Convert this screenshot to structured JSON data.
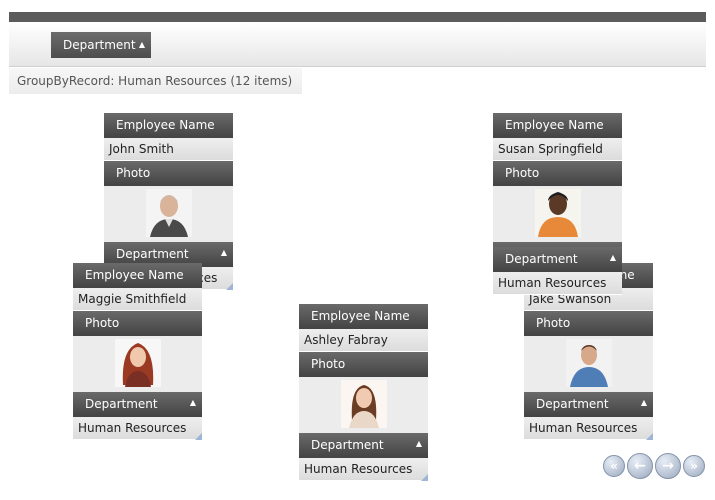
{
  "toolbar": {
    "group_chip_label": "Department"
  },
  "group": {
    "label": "GroupByRecord: Human Resources (12 items)"
  },
  "labels": {
    "name_header": "Employee Name",
    "photo_header": "Photo",
    "dept_header": "Department"
  },
  "cards": [
    {
      "name": "John Smith",
      "department": "Human Resources",
      "photo": "avatar-man-grey-hair"
    },
    {
      "name": "Susan Springfield",
      "department": "Human Resources",
      "photo": "avatar-woman-orange-top"
    },
    {
      "name": "Maggie Smithfield",
      "department": "Human Resources",
      "photo": "avatar-woman-red-hair"
    },
    {
      "name": "Jake Swanson",
      "department": "Human Resources",
      "photo": "avatar-man-denim-shirt"
    },
    {
      "name": "Ashley Fabray",
      "department": "Human Resources",
      "photo": "avatar-woman-brown-hair"
    }
  ],
  "pager": {
    "first_icon": "double-left-icon",
    "prev_icon": "left-arrow-icon",
    "next_icon": "right-arrow-icon",
    "last_icon": "double-right-icon"
  },
  "colors": {
    "header_dark": "#4d4d4d",
    "topbar": "#5b5b5b",
    "resize_accent": "#9fb5d8"
  }
}
